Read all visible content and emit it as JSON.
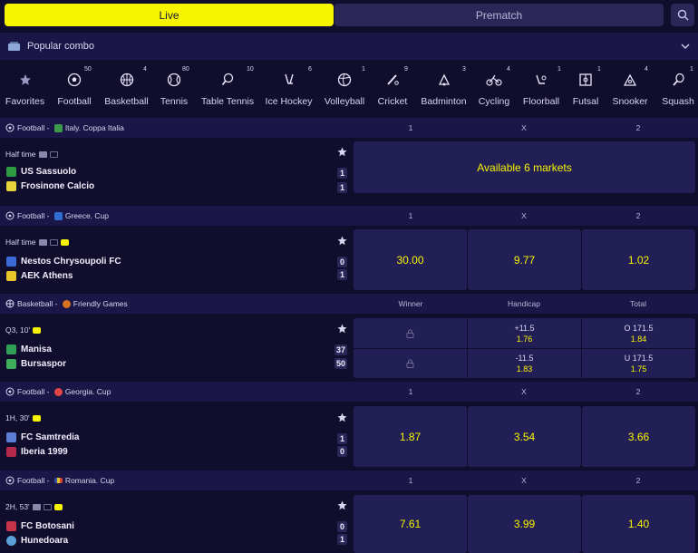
{
  "tabs": {
    "live": "Live",
    "prematch": "Prematch"
  },
  "combo": {
    "label": "Popular combo"
  },
  "sports": [
    {
      "label": "Favorites",
      "count": "",
      "icon": "star-icon"
    },
    {
      "label": "Football",
      "count": "50",
      "icon": "football-icon"
    },
    {
      "label": "Basketball",
      "count": "4",
      "icon": "basketball-icon"
    },
    {
      "label": "Tennis",
      "count": "80",
      "icon": "tennis-icon"
    },
    {
      "label": "Table Tennis",
      "count": "10",
      "icon": "table-tennis-icon"
    },
    {
      "label": "Ice Hockey",
      "count": "6",
      "icon": "ice-hockey-icon"
    },
    {
      "label": "Volleyball",
      "count": "1",
      "icon": "volleyball-icon"
    },
    {
      "label": "Cricket",
      "count": "9",
      "icon": "cricket-icon"
    },
    {
      "label": "Badminton",
      "count": "3",
      "icon": "badminton-icon"
    },
    {
      "label": "Cycling",
      "count": "4",
      "icon": "cycling-icon"
    },
    {
      "label": "Floorball",
      "count": "1",
      "icon": "floorball-icon"
    },
    {
      "label": "Futsal",
      "count": "1",
      "icon": "futsal-icon"
    },
    {
      "label": "Snooker",
      "count": "4",
      "icon": "snooker-icon"
    },
    {
      "label": "Squash",
      "count": "1",
      "icon": "squash-icon"
    }
  ],
  "leagues": [
    {
      "sport": "Football",
      "sep": " - ",
      "league": "Italy. Coppa Italia",
      "flag_color": "#3b9b4a",
      "cols": [
        "1",
        "X",
        "2"
      ],
      "status": "Half time",
      "team1": "US Sassuolo",
      "team2": "Frosinone Calcio",
      "score1": "1",
      "score2": "1",
      "markets": "Available 6 markets"
    },
    {
      "sport": "Football",
      "sep": " - ",
      "league": "Greece. Cup",
      "flag_color": "#2f6dd1",
      "cols": [
        "1",
        "X",
        "2"
      ],
      "status": "Half time",
      "team1": "Nestos Chrysoupoli FC",
      "team2": "AEK Athens",
      "score1": "0",
      "score2": "1",
      "odds": [
        "30.00",
        "9.77",
        "1.02"
      ]
    },
    {
      "sport": "Basketball",
      "sep": " - ",
      "league": "Friendly Games",
      "flag_color": "#d7721e",
      "cols": [
        "Winner",
        "Handicap",
        "Total"
      ],
      "status": "Q3, 10'",
      "team1": "Manisa",
      "team2": "Bursaspor",
      "score1": "37",
      "score2": "50",
      "handicap": [
        {
          "line": "+11.5",
          "odd": "1.76"
        },
        {
          "line": "-11.5",
          "odd": "1.83"
        }
      ],
      "total": [
        {
          "line": "O 171.5",
          "odd": "1.84"
        },
        {
          "line": "U 171.5",
          "odd": "1.75"
        }
      ]
    },
    {
      "sport": "Football",
      "sep": " - ",
      "league": "Georgia. Cup",
      "flag_color": "#e04545",
      "cols": [
        "1",
        "X",
        "2"
      ],
      "status": "1H, 30'",
      "team1": "FC Samtredia",
      "team2": "Iberia 1999",
      "score1": "1",
      "score2": "0",
      "odds": [
        "1.87",
        "3.54",
        "3.66"
      ]
    },
    {
      "sport": "Football",
      "sep": " - ",
      "league": "Romania. Cup",
      "flag_color": "#d8443a",
      "cols": [
        "1",
        "X",
        "2"
      ],
      "status": "2H, 53'",
      "team1": "FC Botosani",
      "team2": "Hunedoara",
      "score1": "0",
      "score2": "1",
      "odds": [
        "7.61",
        "3.99",
        "1.40"
      ]
    }
  ]
}
